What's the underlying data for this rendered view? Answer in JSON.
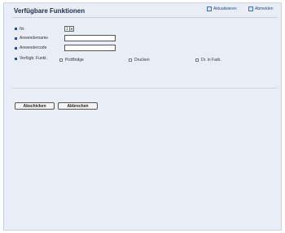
{
  "page": {
    "title": "Verfügbare Funktionen"
  },
  "header": {
    "refresh_label": "Aktualisieren",
    "logout_label": "Abmelden"
  },
  "form": {
    "nr_label": "Nr.",
    "nr_value": "1",
    "user_name_label": "Anwendername",
    "user_name_value": "",
    "user_code_label": "Anwendercode",
    "user_code_value": "",
    "functions_label": "Verfügb. Funkt.",
    "functions": [
      {
        "label": "PictBridge",
        "checked": false
      },
      {
        "label": "Drucken",
        "checked": false
      },
      {
        "label": "Dr. in Farb.",
        "checked": false
      }
    ]
  },
  "buttons": {
    "submit_label": "Abschicken",
    "cancel_label": "Abbrechen"
  },
  "colors": {
    "accent": "#2a4d8f",
    "panel": "#e9eef6"
  }
}
